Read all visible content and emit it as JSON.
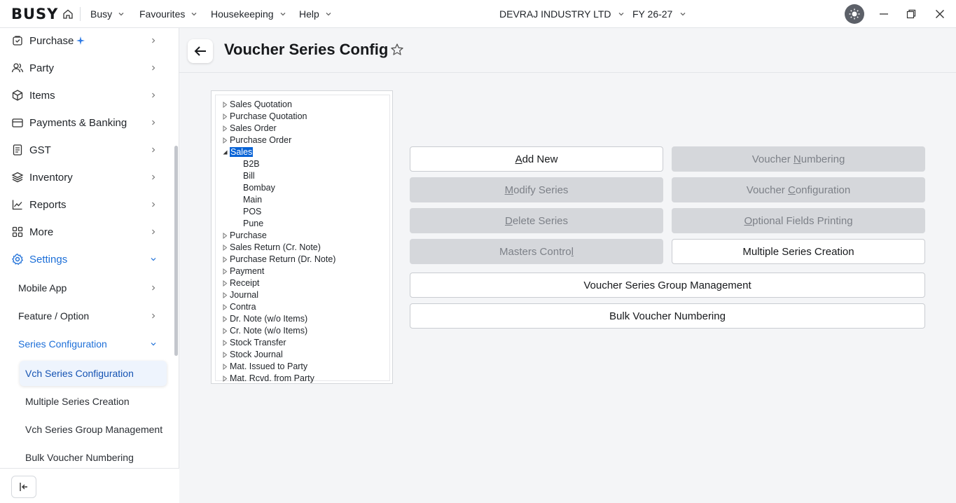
{
  "topbar": {
    "logo": "BUSY",
    "menus": [
      "Busy",
      "Favourites",
      "Housekeeping",
      "Help"
    ],
    "company": "DEVRAJ INDUSTRY LTD",
    "fy": "FY 26-27"
  },
  "sidebar": {
    "items": [
      {
        "label": "Purchase",
        "icon": "purchase-icon"
      },
      {
        "label": "Party",
        "icon": "party-icon"
      },
      {
        "label": "Items",
        "icon": "items-icon"
      },
      {
        "label": "Payments & Banking",
        "icon": "wallet-icon"
      },
      {
        "label": "GST",
        "icon": "gst-icon"
      },
      {
        "label": "Inventory",
        "icon": "layers-icon"
      },
      {
        "label": "Reports",
        "icon": "chart-icon"
      },
      {
        "label": "More",
        "icon": "grid-icon"
      },
      {
        "label": "Settings",
        "icon": "gear-icon"
      }
    ],
    "settings_sub": [
      {
        "label": "Mobile App"
      },
      {
        "label": "Feature / Option"
      },
      {
        "label": "Series Configuration"
      }
    ],
    "series_sub": [
      {
        "label": "Vch Series Configuration"
      },
      {
        "label": "Multiple Series Creation"
      },
      {
        "label": "Vch Series Group Management"
      },
      {
        "label": "Bulk Voucher Numbering"
      }
    ]
  },
  "page": {
    "title": "Voucher Series Config"
  },
  "tree": {
    "nodes": [
      "Sales Quotation",
      "Purchase Quotation",
      "Sales Order",
      "Purchase Order",
      "Sales"
    ],
    "sales_children": [
      "B2B",
      "Bill",
      "Bombay",
      "Main",
      "POS",
      "Pune"
    ],
    "after_nodes": [
      "Purchase",
      "Sales Return (Cr. Note)",
      "Purchase Return (Dr. Note)",
      "Payment",
      "Receipt",
      "Journal",
      "Contra",
      "Dr. Note (w/o Items)",
      "Cr. Note (w/o Items)",
      "Stock Transfer",
      "Stock Journal",
      "Mat. Issued to Party",
      "Mat. Rcvd. from Party"
    ]
  },
  "buttons": {
    "add_new": {
      "pre": "",
      "u": "A",
      "post": "dd New"
    },
    "voucher_numbering": {
      "pre": "Voucher ",
      "u": "N",
      "post": "umbering"
    },
    "modify_series": {
      "pre": "",
      "u": "M",
      "post": "odify Series"
    },
    "voucher_configuration": {
      "pre": "Voucher ",
      "u": "C",
      "post": "onfiguration"
    },
    "delete_series": {
      "pre": "",
      "u": "D",
      "post": "elete Series"
    },
    "optional_fields": {
      "pre": "",
      "u": "O",
      "post": "ptional Fields Printing"
    },
    "masters_control": {
      "pre": "Masters Contro",
      "u": "l",
      "post": ""
    },
    "multiple_series": "Multiple Series Creation",
    "group_mgmt": "Voucher Series Group Management",
    "bulk_numbering": "Bulk Voucher Numbering"
  }
}
